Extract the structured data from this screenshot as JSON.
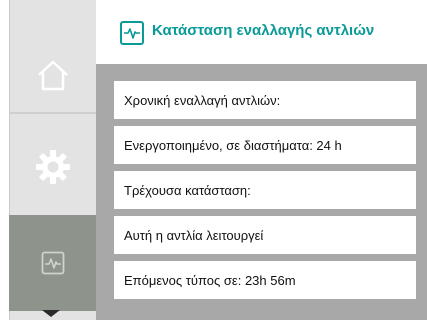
{
  "header": {
    "title": "Κατάσταση εναλλαγής αντλιών",
    "icon": "pump-exchange-icon",
    "accent_color": "#0a9a98"
  },
  "nav": {
    "items": [
      {
        "name": "home",
        "icon": "home-icon"
      },
      {
        "name": "settings",
        "icon": "gear-icon"
      },
      {
        "name": "diagnostics",
        "icon": "diagnostics-icon",
        "active": true
      }
    ],
    "scroll_indicator": "chevron-down-icon"
  },
  "list": {
    "items": [
      "Χρονική εναλλαγή αντλιών:",
      "Ενεργοποιημένο, σε διαστήματα: 24 h",
      "Τρέχουσα κατάσταση:",
      "Αυτή η αντλία λειτουργεί",
      "Επόμενος τύπος σε: 23h 56m"
    ]
  }
}
